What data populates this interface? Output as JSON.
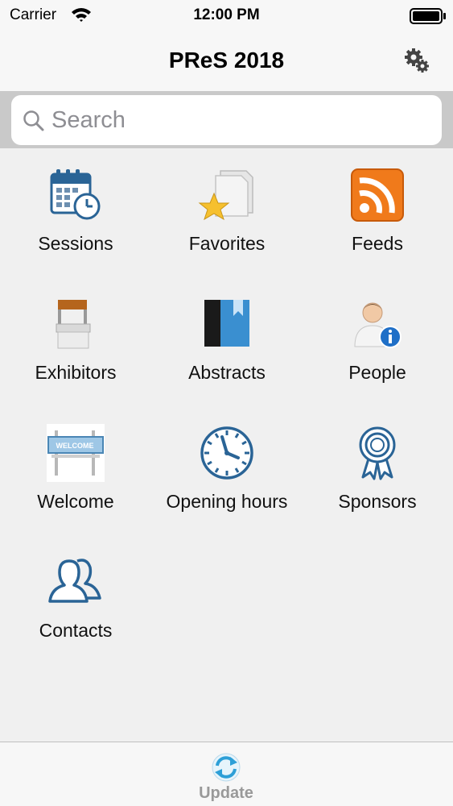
{
  "status_bar": {
    "carrier": "Carrier",
    "time": "12:00 PM"
  },
  "nav": {
    "title": "PReS 2018",
    "settings_icon": "gears-icon"
  },
  "search": {
    "placeholder": "Search",
    "value": ""
  },
  "grid": [
    {
      "label": "Sessions",
      "icon": "calendar-clock-icon"
    },
    {
      "label": "Favorites",
      "icon": "star-folder-icon"
    },
    {
      "label": "Feeds",
      "icon": "rss-icon"
    },
    {
      "label": "Exhibitors",
      "icon": "booth-icon"
    },
    {
      "label": "Abstracts",
      "icon": "book-icon"
    },
    {
      "label": "People",
      "icon": "person-info-icon"
    },
    {
      "label": "Welcome",
      "icon": "welcome-sign-icon"
    },
    {
      "label": "Opening hours",
      "icon": "clock-icon"
    },
    {
      "label": "Sponsors",
      "icon": "ribbon-icon"
    },
    {
      "label": "Contacts",
      "icon": "contacts-icon"
    }
  ],
  "tab_bar": {
    "update_label": "Update",
    "update_icon": "refresh-icon"
  },
  "colors": {
    "accent_blue": "#2a6496",
    "feeds_orange": "#f07a1b",
    "update_gray": "#999999"
  }
}
